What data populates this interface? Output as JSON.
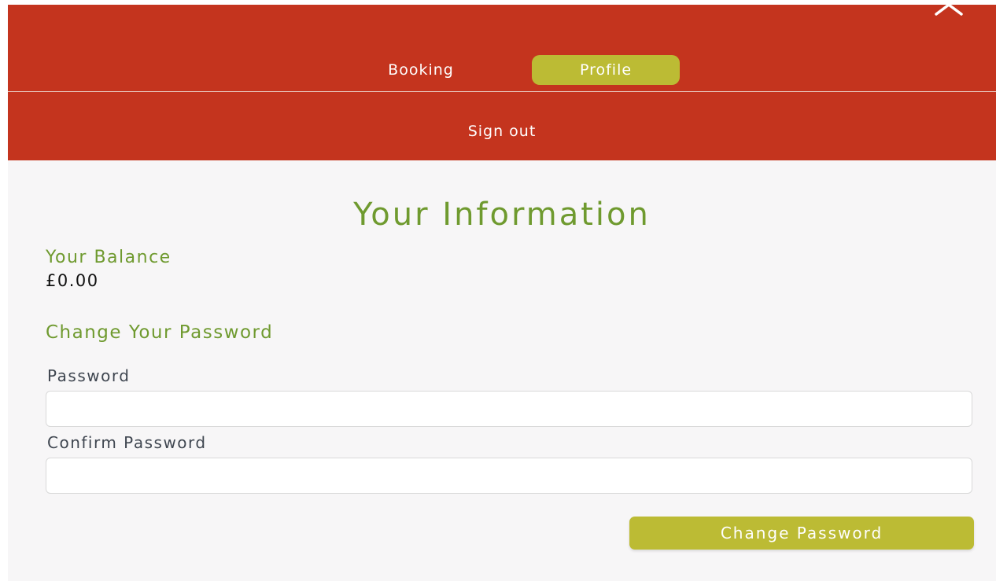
{
  "nav": {
    "tabs": [
      {
        "label": "Booking"
      },
      {
        "label": "Profile"
      }
    ],
    "active_tab": "Profile",
    "signout_label": "Sign out",
    "close_icon": "close-icon"
  },
  "main": {
    "title": "Your Information",
    "balance": {
      "label": "Your Balance",
      "value": "£0.00"
    },
    "password_section": {
      "heading": "Change Your Password",
      "password_label": "Password",
      "password_value": "",
      "confirm_label": "Confirm Password",
      "confirm_value": "",
      "submit_label": "Change Password"
    }
  },
  "colors": {
    "nav_background": "#c4341e",
    "accent_button": "#bcbb34",
    "heading_green": "#6f9a2f",
    "page_background": "#f7f6f7"
  }
}
